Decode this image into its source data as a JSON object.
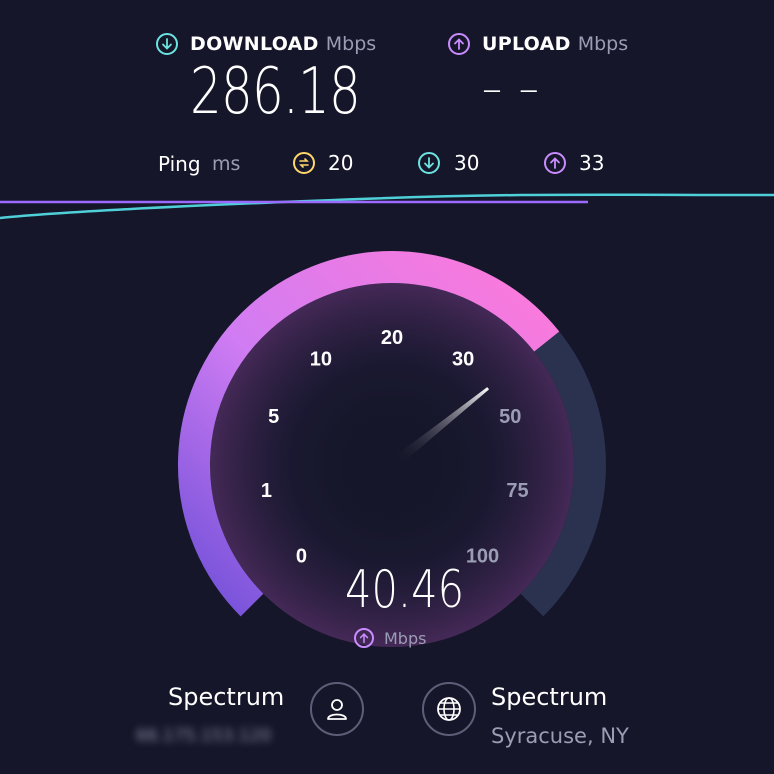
{
  "download": {
    "label": "DOWNLOAD",
    "unit": "Mbps",
    "value": "286.18",
    "icon": "download-arrow-icon",
    "color": "#6be3e0"
  },
  "upload": {
    "label": "UPLOAD",
    "unit": "Mbps",
    "value": "– –",
    "icon": "upload-arrow-icon",
    "color": "#c98cff"
  },
  "ping": {
    "label": "Ping",
    "unit": "ms",
    "idle": {
      "value": "20",
      "icon": "idle-latency-icon",
      "color": "#ffd66b"
    },
    "download": {
      "value": "30",
      "icon": "download-latency-icon",
      "color": "#6be3e0"
    },
    "upload": {
      "value": "33",
      "icon": "upload-latency-icon",
      "color": "#c98cff"
    }
  },
  "gauge": {
    "ticks": [
      "0",
      "1",
      "5",
      "10",
      "20",
      "30",
      "50",
      "75",
      "100"
    ],
    "current_value": "40.46",
    "unit": "Mbps",
    "needle_value": 40.46,
    "fill_colors": [
      "#6f4fd8",
      "#d97cf5",
      "#ff7ad9"
    ],
    "track_color": "#2a3250"
  },
  "isp": {
    "client": {
      "name": "Spectrum",
      "ip": "66.175.153.120",
      "icon": "user-icon"
    },
    "server": {
      "name": "Spectrum",
      "location": "Syracuse, NY",
      "icon": "globe-icon"
    }
  }
}
